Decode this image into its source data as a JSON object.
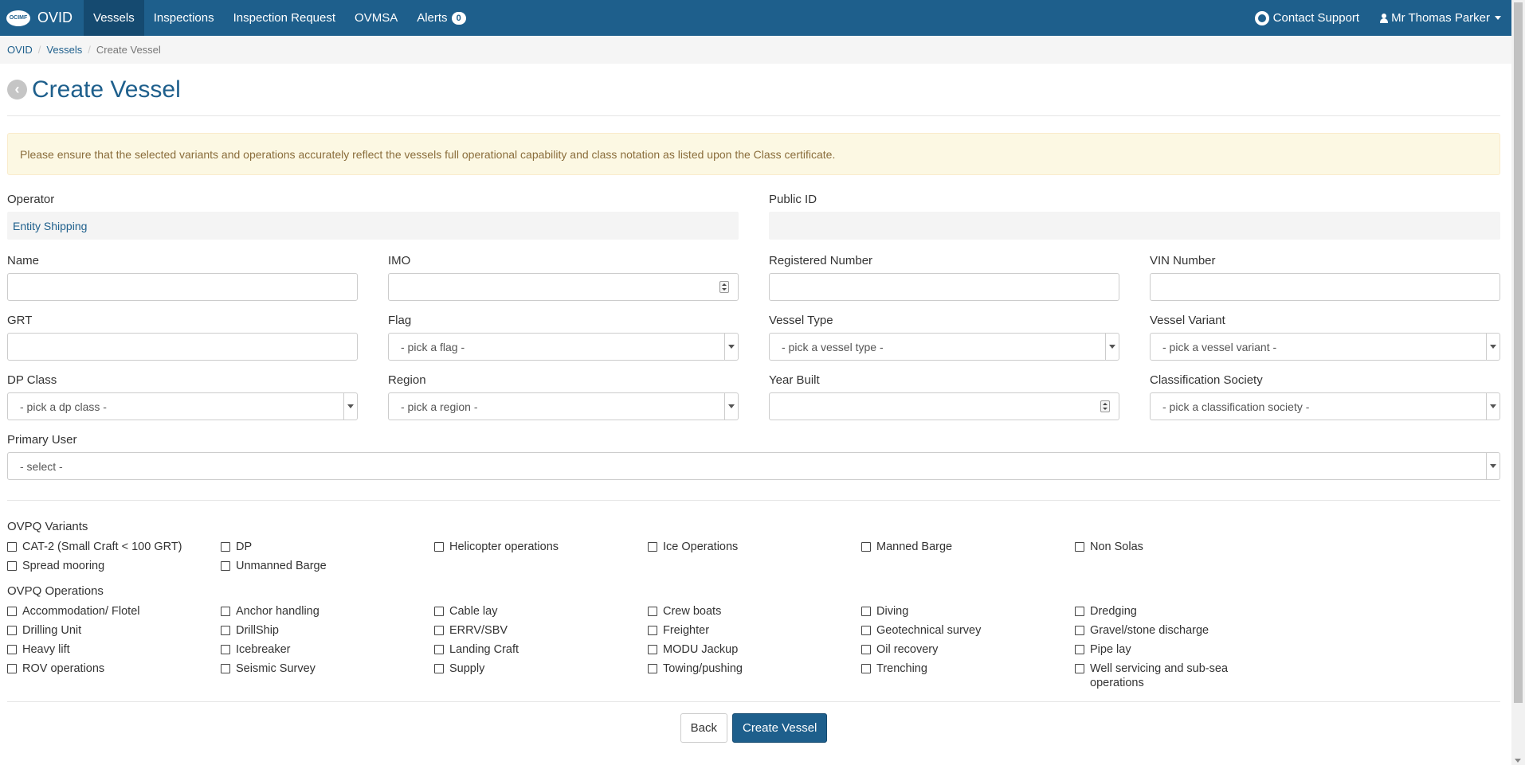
{
  "nav": {
    "logo_text": "OCIMF",
    "brand": "OVID",
    "items": [
      {
        "label": "Vessels"
      },
      {
        "label": "Inspections"
      },
      {
        "label": "Inspection Request"
      },
      {
        "label": "OVMSA"
      },
      {
        "label": "Alerts",
        "badge": "0"
      }
    ],
    "contact": "Contact Support",
    "user": "Mr Thomas Parker"
  },
  "breadcrumb": [
    "OVID",
    "Vessels",
    "Create Vessel"
  ],
  "page": {
    "title": "Create Vessel",
    "alert": "Please ensure that the selected variants and operations accurately reflect the vessels full operational capability and class notation as listed upon the Class certificate."
  },
  "form": {
    "operator_label": "Operator",
    "operator_value": "Entity Shipping",
    "public_id_label": "Public ID",
    "public_id_value": "",
    "name_label": "Name",
    "imo_label": "IMO",
    "registered_number_label": "Registered Number",
    "vin_label": "VIN Number",
    "grt_label": "GRT",
    "flag_label": "Flag",
    "flag_value": "- pick a flag -",
    "vessel_type_label": "Vessel Type",
    "vessel_type_value": "- pick a vessel type -",
    "vessel_variant_label": "Vessel Variant",
    "vessel_variant_value": "- pick a vessel variant -",
    "dp_class_label": "DP Class",
    "dp_class_value": "- pick a dp class -",
    "region_label": "Region",
    "region_value": "- pick a region -",
    "year_built_label": "Year Built",
    "class_society_label": "Classification Society",
    "class_society_value": "- pick a classification society -",
    "primary_user_label": "Primary User",
    "primary_user_value": "- select -"
  },
  "variants": {
    "title": "OVPQ Variants",
    "items": [
      "CAT-2 (Small Craft < 100 GRT)",
      "DP",
      "Helicopter operations",
      "Ice Operations",
      "Manned Barge",
      "Non Solas",
      "Spread mooring",
      "Unmanned Barge"
    ]
  },
  "operations": {
    "title": "OVPQ Operations",
    "items": [
      "Accommodation/ Flotel",
      "Anchor handling",
      "Cable lay",
      "Crew boats",
      "Diving",
      "Dredging",
      "Drilling Unit",
      "DrillShip",
      "ERRV/SBV",
      "Freighter",
      "Geotechnical survey",
      "Gravel/stone discharge",
      "Heavy lift",
      "Icebreaker",
      "Landing Craft",
      "MODU Jackup",
      "Oil recovery",
      "Pipe lay",
      "ROV operations",
      "Seismic Survey",
      "Supply",
      "Towing/pushing",
      "Trenching",
      "Well servicing and sub-sea operations"
    ]
  },
  "buttons": {
    "back": "Back",
    "create": "Create Vessel"
  }
}
